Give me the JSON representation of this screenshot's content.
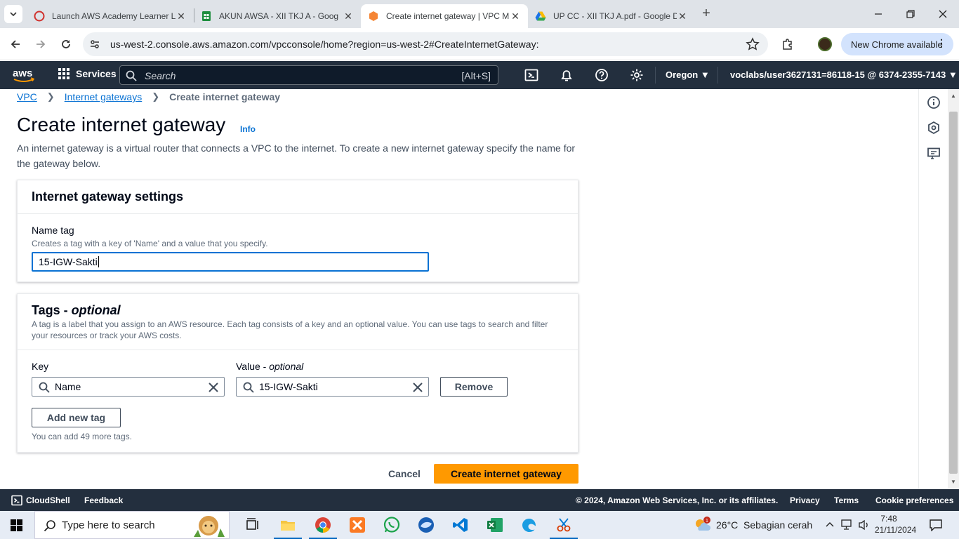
{
  "browser": {
    "tabs": [
      {
        "title": "Launch AWS Academy Learner L",
        "favicon": "aws-academy-icon",
        "active": false
      },
      {
        "title": "AKUN AWSA - XII TKJ A - Goog",
        "favicon": "google-sheets-icon",
        "active": false
      },
      {
        "title": "Create internet gateway | VPC M",
        "favicon": "aws-vpc-icon",
        "active": true
      },
      {
        "title": "UP CC - XII TKJ A.pdf - Google D",
        "favicon": "google-drive-icon",
        "active": false
      }
    ],
    "url": "us-west-2.console.aws.amazon.com/vpcconsole/home?region=us-west-2#CreateInternetGateway:",
    "new_chrome_label": "New Chrome available"
  },
  "aws_nav": {
    "logo": "aws",
    "services_label": "Services",
    "search_placeholder": "Search",
    "search_shortcut": "[Alt+S]",
    "region": "Oregon",
    "account": "voclabs/user3627131=86118-15 @ 6374-2355-7143"
  },
  "breadcrumb": {
    "items": [
      "VPC",
      "Internet gateways",
      "Create internet gateway"
    ]
  },
  "page": {
    "title": "Create internet gateway",
    "info_label": "Info",
    "description": "An internet gateway is a virtual router that connects a VPC to the internet. To create a new internet gateway specify the name for the gateway below."
  },
  "settings_panel": {
    "title": "Internet gateway settings",
    "name_tag_label": "Name tag",
    "name_tag_hint": "Creates a tag with a key of 'Name' and a value that you specify.",
    "name_tag_value": "15-IGW-Sakti"
  },
  "tags_panel": {
    "title_main": "Tags - ",
    "title_optional": "optional",
    "description": "A tag is a label that you assign to an AWS resource. Each tag consists of a key and an optional value. You can use tags to search and filter your resources or track your AWS costs.",
    "key_label": "Key",
    "value_label_main": "Value - ",
    "value_label_optional": "optional",
    "tags": [
      {
        "key": "Name",
        "value": "15-IGW-Sakti"
      }
    ],
    "remove_label": "Remove",
    "add_label": "Add new tag",
    "limit_hint": "You can add 49 more tags."
  },
  "actions": {
    "cancel_label": "Cancel",
    "create_label": "Create internet gateway"
  },
  "footer": {
    "cloudshell": "CloudShell",
    "feedback": "Feedback",
    "copyright": "© 2024, Amazon Web Services, Inc. or its affiliates.",
    "privacy": "Privacy",
    "terms": "Terms",
    "cookies": "Cookie preferences"
  },
  "taskbar": {
    "search_placeholder": "Type here to search",
    "weather": "26°C  Sebagian cerah",
    "weather_badge": "1",
    "time": "7:48",
    "date": "21/11/2024"
  },
  "colors": {
    "aws_nav_bg": "#232f3e",
    "primary_button": "#ff9900",
    "link": "#0972d3",
    "focus_border": "#0972d3"
  }
}
